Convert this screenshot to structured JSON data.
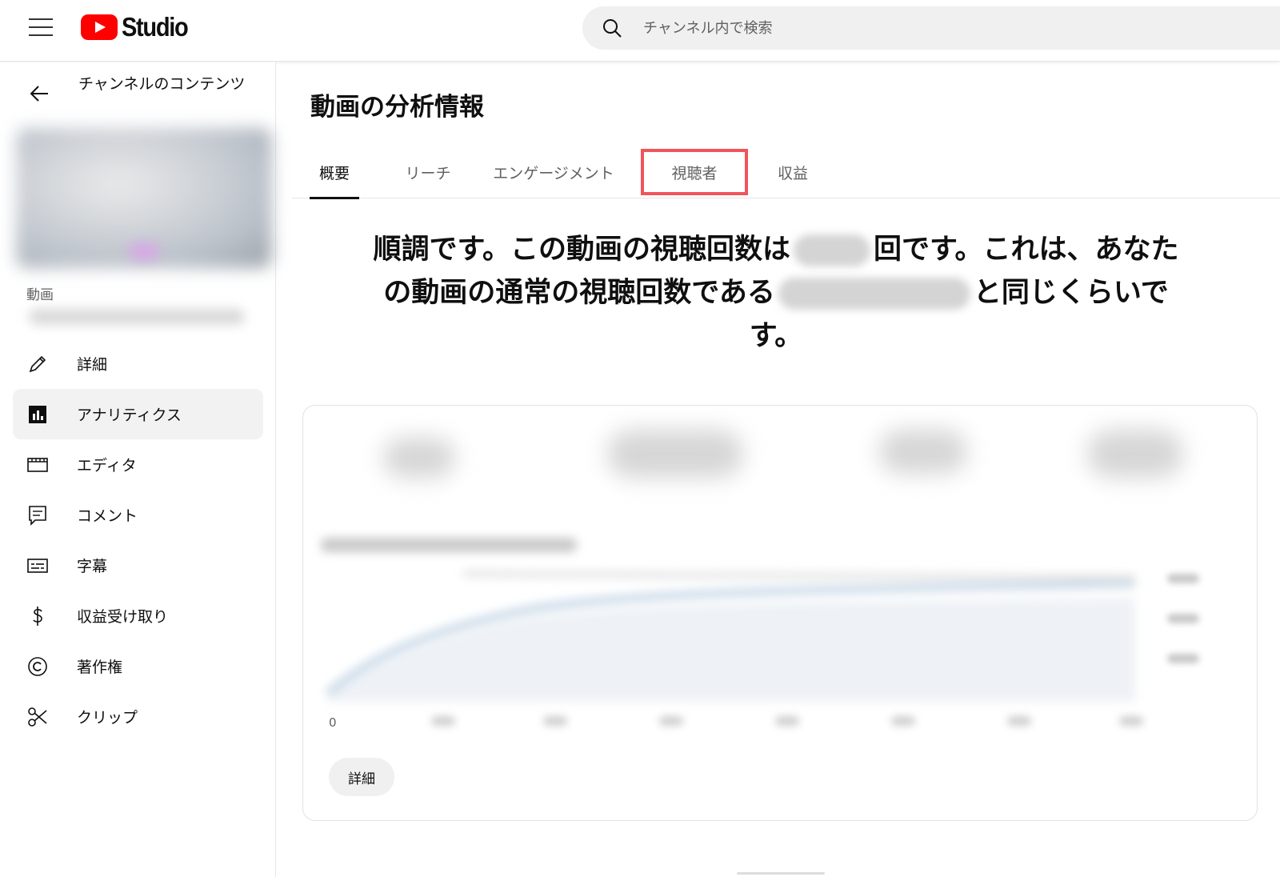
{
  "app": {
    "brand_text": "Studio",
    "brand_color": "#ff0000",
    "accent_highlight_color": "#f0555a"
  },
  "header": {
    "menu_icon": "hamburger-menu-icon",
    "search_placeholder": "チャンネル内で検索"
  },
  "sidebar": {
    "back_title": "チャンネルのコンテンツ",
    "video_label": "動画",
    "items": [
      {
        "label": "詳細",
        "icon": "pencil-icon",
        "active": false
      },
      {
        "label": "アナリティクス",
        "icon": "analytics-icon",
        "active": true
      },
      {
        "label": "エディタ",
        "icon": "clapperboard-icon",
        "active": false
      },
      {
        "label": "コメント",
        "icon": "comment-icon",
        "active": false
      },
      {
        "label": "字幕",
        "icon": "subtitles-icon",
        "active": false
      },
      {
        "label": "収益受け取り",
        "icon": "dollar-icon",
        "active": false
      },
      {
        "label": "著作権",
        "icon": "copyright-icon",
        "active": false
      },
      {
        "label": "クリップ",
        "icon": "scissors-icon",
        "active": false
      }
    ]
  },
  "main": {
    "title": "動画の分析情報",
    "tabs": [
      {
        "label": "概要",
        "active": true,
        "highlighted": false
      },
      {
        "label": "リーチ",
        "active": false,
        "highlighted": false
      },
      {
        "label": "エンゲージメント",
        "active": false,
        "highlighted": false
      },
      {
        "label": "視聴者",
        "active": false,
        "highlighted": true
      },
      {
        "label": "収益",
        "active": false,
        "highlighted": false
      }
    ],
    "headline": {
      "part1": "順調です。この動画の視聴回数は",
      "part2": "回です。これは、あなたの動画の通常の視聴回数である",
      "part3": "と同じくらいです。"
    },
    "card": {
      "chart_zero_label": "0",
      "detail_button": "詳細"
    }
  }
}
